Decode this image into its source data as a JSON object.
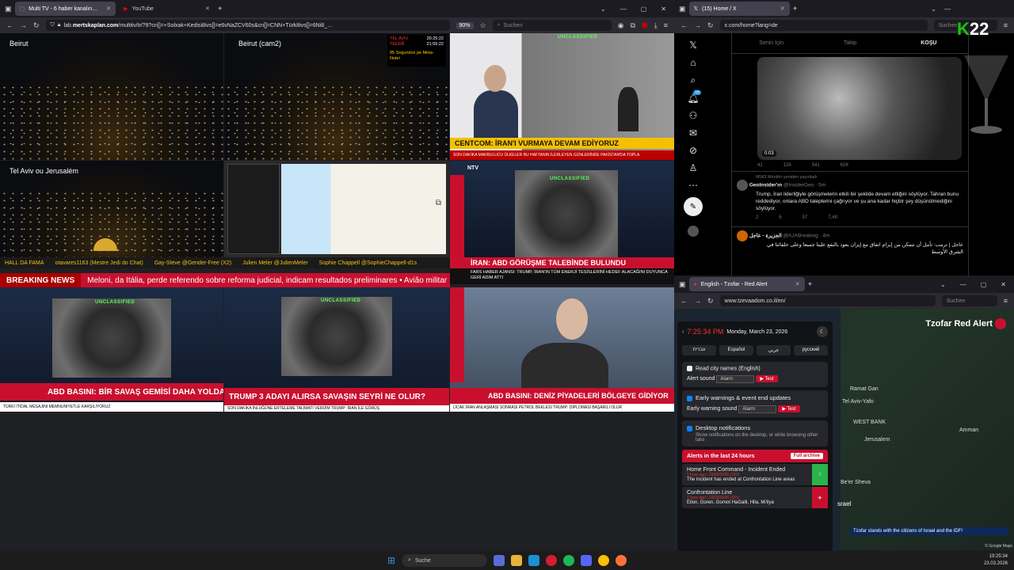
{
  "left_browser": {
    "tabs": [
      {
        "label": "Multi TV - 6 haber kanalın…"
      },
      {
        "label": "YouTube"
      }
    ],
    "new_tab": "+",
    "url_prefix": "lab.",
    "url_domain": "mertskaplan.com",
    "url_rest": "/multitv/tr/?9?cn[]=+Solxak+Kedisi8ivs[]=e6vNaZCV60s&cn[]=CNN+Türk8ivs[]=6Ni8_…",
    "zoom": "90%",
    "search_placeholder": "Suchen"
  },
  "feeds": {
    "beirut": "Beirut",
    "beirut_cam2": "Beirut (cam2)",
    "telaviv": "Tel Aviv ou Jerusalém",
    "cnn_chyron": "CENTCOM: İRAN'I VURMAYA DEVAM EDİYORUZ",
    "cnn_sub": "SON DAKİKA  MAKBULUCU ÜLKELER BU HAFTANIN İLERLEYEN GÜNLERİNDE PAKİSTAN'DA TOPLA",
    "ntv_chyron": "İRAN: ABD GÖRÜŞME TALEBİNDE BULUNDU",
    "ntv_sub": "FARS HABER AJANSI: TRUMP, İRAN'IN TÜM ENERJİ TESİSLERİNİ HEDEF ALACAĞINI DUYUNCA GERİ ADIM ATTI",
    "son_dakika": "SON DAKİKA",
    "haberturk_chyron": "ABD BASINI: BİR SAVAŞ GEMİSİ DAHA YOLDA",
    "haberturk_sub": "TÜRKİ İTİDAL MESAJINI MEMNUNİYETLE KARŞILIYORUZ",
    "haberglobal_chyron": "TRUMP 3 ADAYI ALIRSA SAVAŞIN SEYRİ NE OLUR?",
    "haberglobal_sub": "SON DAKİKA  İNLÜĞÜNE ERTELEME TALİMATI VERDİM   TRUMP: İRAN İLE GÖRÜŞ",
    "ahaber_chyron": "ABD BASINI: DENİZ PİYADELERİ BÖLGEYE GİDİYOR",
    "ahaber_sub": "LİCAK  İRAN ANLAŞMASI SONRASI PETROL BEKLESİ   TRUMP: DİPLOMASİ BAŞARILI OLUR",
    "unclassified": "UNCLASSIFIED",
    "clock_a": "20:25:22",
    "clock_b": "21:55:22",
    "tel_aviv_lbl": "TEL AVIV",
    "tehran_lbl": "TEERÃ",
    "alert_note": "85 Segundos pe Meta-Notei"
  },
  "ticker": [
    "HALL DA FAMA",
    "otavares1163 (Mestre Jedi do Chat)",
    "Gay-Steve @Gender-Free (X2)",
    "Julien Meler @JulienMeler",
    "Sophie Chappell @SophieChappell-d1s"
  ],
  "breaking": {
    "tag": "BREAKING NEWS",
    "text": "Meloni, da Itália, perde referendo sobre reforma judicial, indicam resultados preliminares  •  Avião militar"
  },
  "right_browser": {
    "tab": "(15) Home / X",
    "url": "x.com/home?lang=de",
    "search_placeholder": "Suchen"
  },
  "x": {
    "tabs": [
      "Senin İçin",
      "Takip",
      "KOŞU"
    ],
    "video_time": "0:03",
    "video_stats": [
      "41",
      "126",
      "541",
      "62K"
    ],
    "repost_note": "WW3 Monitör yeniden yayınladı",
    "post1_name": "Geolnsider'ın",
    "post1_handle": "@InsiderGeo · 5m",
    "post1_text": "Trump, İran liderliğiyle görüşmelerin etkili bir şekilde devam ettiğini söylüyor. Tahran bunu reddediyor, onlara ABD taleplerini çağrıyor ve şu ana kadar hiçbir şey düşünülmediğini söylüyor.",
    "post1_stats": [
      "2",
      "6",
      "57",
      "7,4K"
    ],
    "post2_name": "الجزيرة - عاجل",
    "post2_handle": "@AJABreaking · 4m",
    "post2_text": "عاجل | ترمب: تأمل أن نتمكن من إبرام اتفاق مع إيران يعود بالنفع علينا جميعا وعلى حلفائنا في الشرق الأوسط",
    "notif_badge": "15"
  },
  "k22": {
    "k": "K",
    "num": "22"
  },
  "tz_browser": {
    "tab": "English - Tzofar - Red Alert",
    "url": "www.tzevaadom.co.il/en/",
    "search_placeholder": "Suchen"
  },
  "tzofar": {
    "time": "7:25:34 PM",
    "date": "Monday, March 23, 2026",
    "langs": [
      "עברית",
      "Español",
      "عربي",
      "русский"
    ],
    "read_city": "Read city names (English)",
    "alert_sound_label": "Alert sound",
    "alert_sound_value": "Alarm",
    "test": "▶ Test",
    "early_title": "Early warnings & event end updates",
    "early_sound_label": "Early warning sound",
    "early_sound_value": "Alarm",
    "desktop_title": "Desktop notifications",
    "desktop_desc": "Show notifications on the desktop, or while browsing other tabs",
    "alerts_header": "Alerts in the last 24 hours",
    "full_archive": "Full archive",
    "alert1_title": "Home Front Command - Incident Ended",
    "alert1_time": "1 hour ago | 23/03/2026 (18:0",
    "alert1_text": "The incident has ended at Confrontation Line areas",
    "alert2_title": "Confrontation Line",
    "alert2_time": "1 hour ago | 23/03/2026 (18:0",
    "alert2_text": "Eilon, Goren, Gornot HaGalil, Hila, Mi'ilya",
    "map_brand": "Tzofar",
    "map_brand2": "Red Alert",
    "map_banner": "Tzofar stands with the citizens of Israel and the IDF!",
    "map_labels": [
      "Ramat Gan",
      "Tel Aviv-Yafo",
      "WEST BANK",
      "Jerusalem",
      "Be'er Sheva",
      "srael",
      "Amman"
    ],
    "google": "© Google Maps"
  },
  "taskbar": {
    "search": "Suche",
    "time": "19:25:34",
    "date": "23.03.2026"
  }
}
